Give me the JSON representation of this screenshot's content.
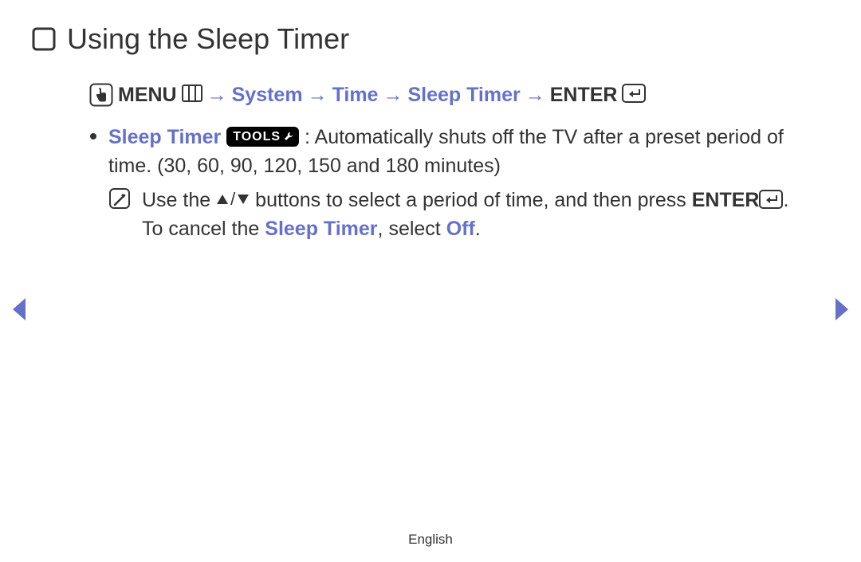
{
  "title": "Using the Sleep Timer",
  "nav": {
    "menu": "MENU",
    "system": "System",
    "time": "Time",
    "sleep_timer": "Sleep Timer",
    "enter": "ENTER",
    "arrow": "→"
  },
  "bullet": {
    "label": "Sleep Timer",
    "tools_label": "TOOLS",
    "desc_1": ": Automatically shuts off the TV after a preset period of time. (30, 60, 90, 120, 150 and 180 minutes)"
  },
  "note": {
    "part1": "Use the ",
    "part2": " buttons to select a period of time, and then press ",
    "enter": "ENTER",
    "part3": ". To cancel the ",
    "sleep_timer": "Sleep Timer",
    "part4": ", select ",
    "off": "Off",
    "part5": "."
  },
  "footer": "English"
}
